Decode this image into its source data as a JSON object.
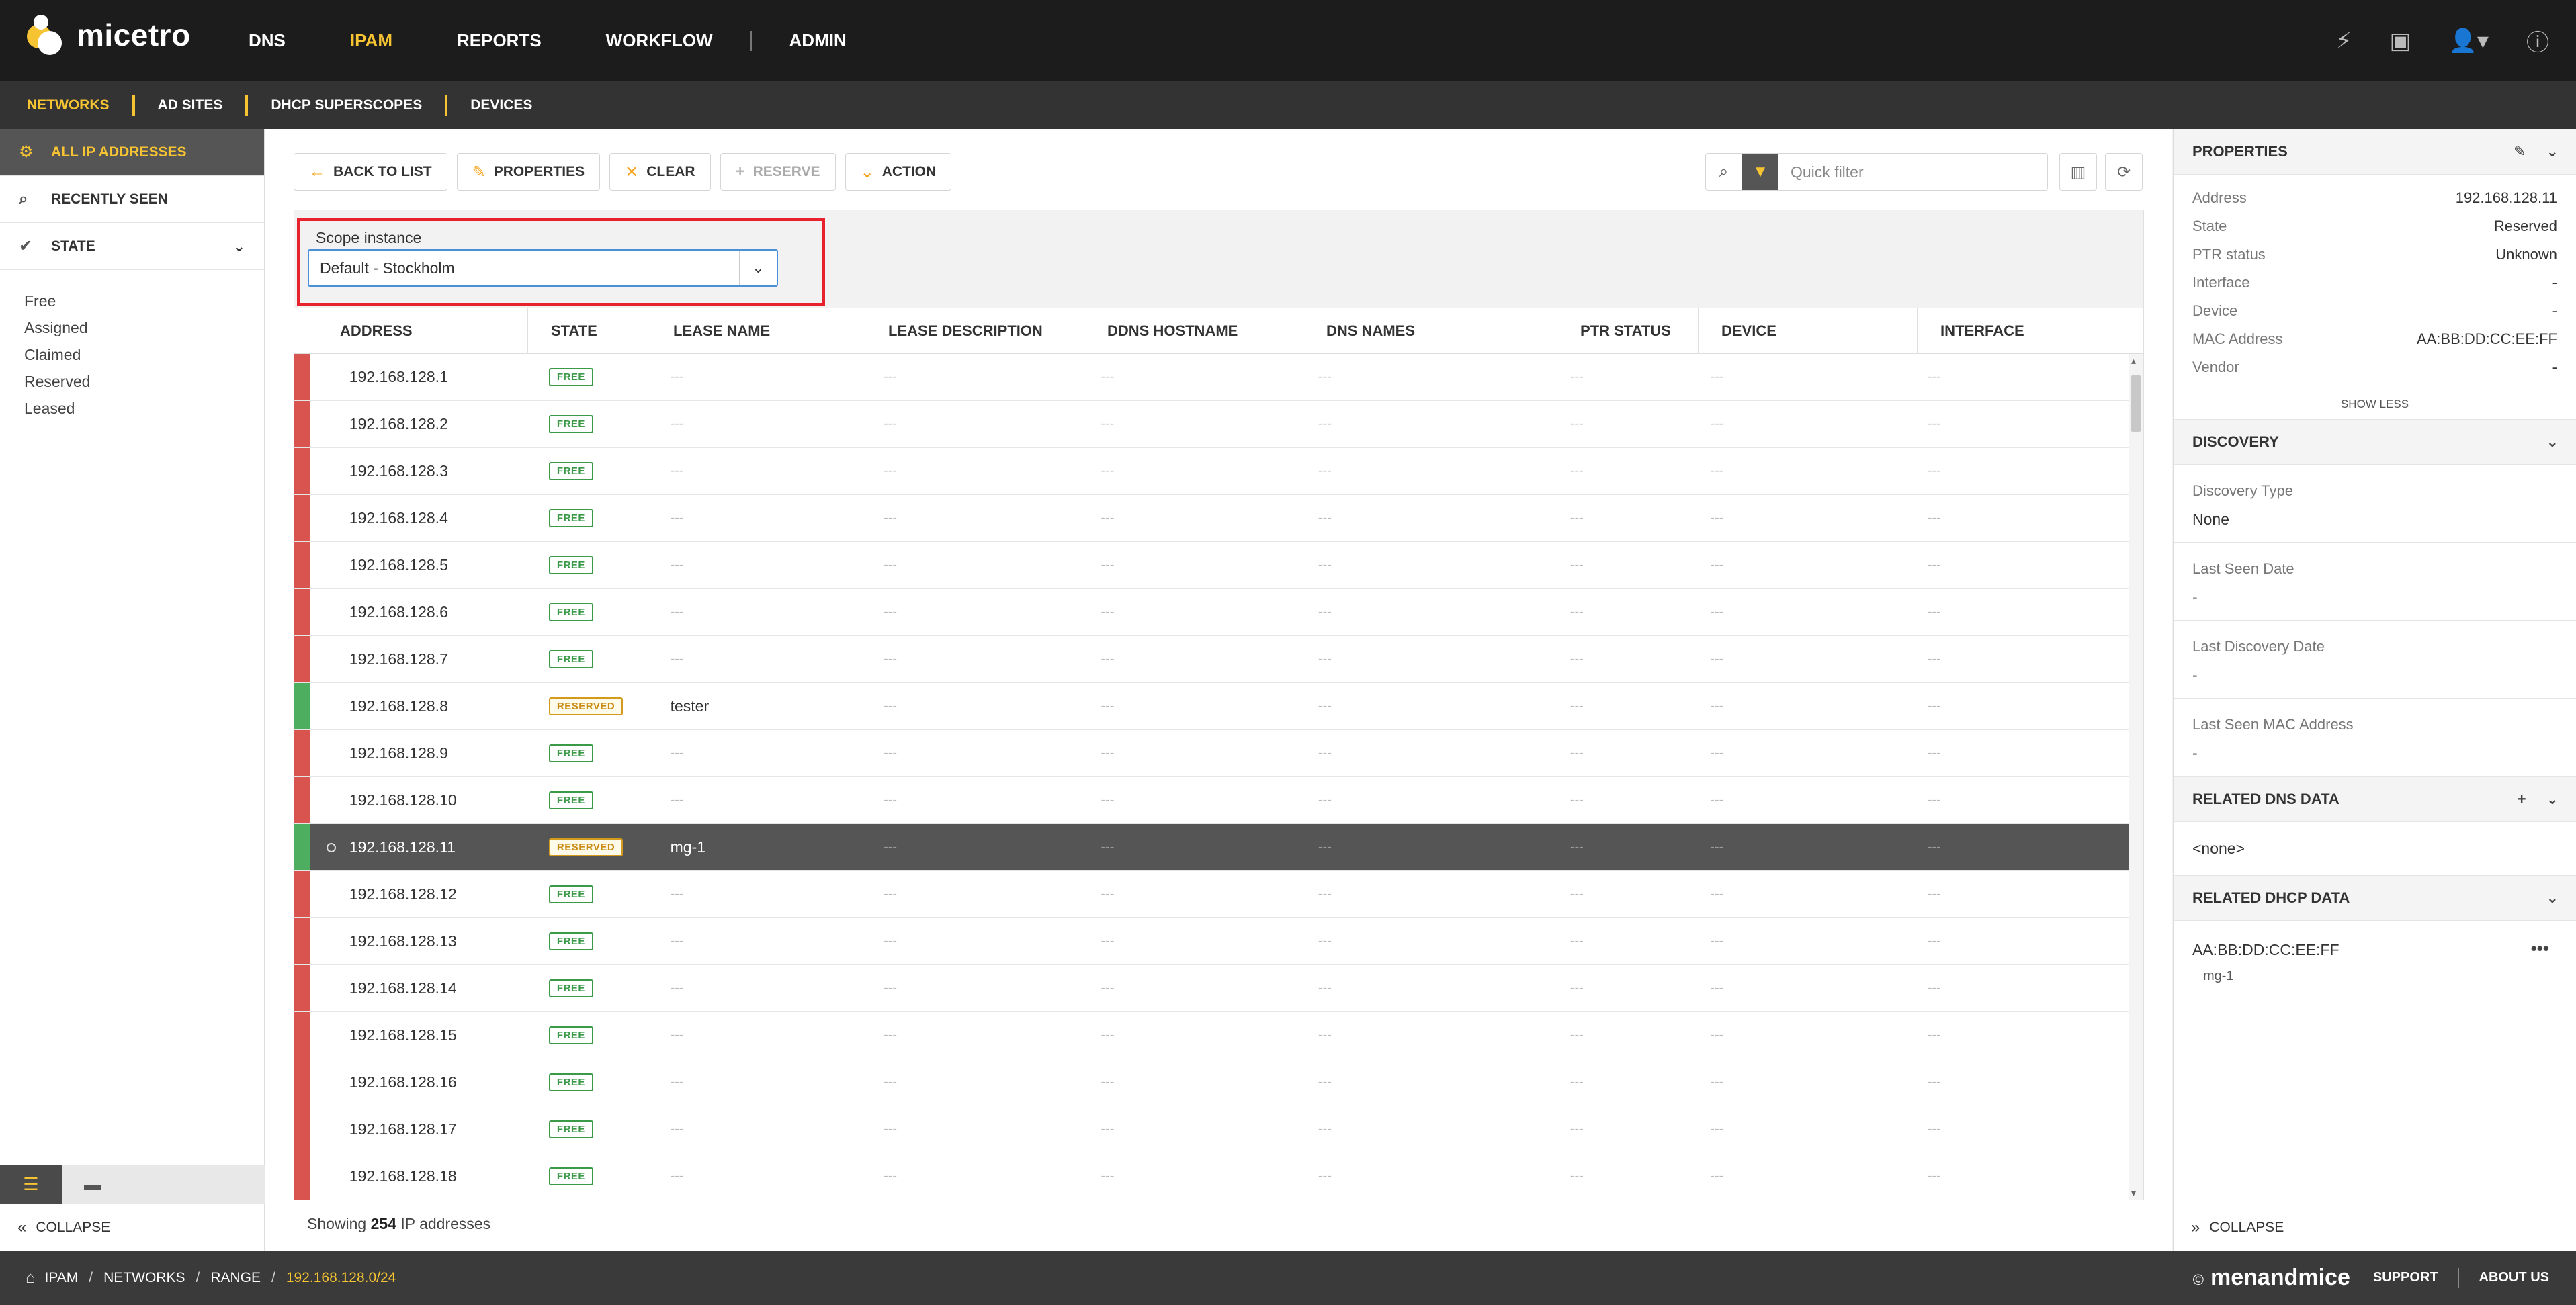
{
  "app": {
    "name": "micetro"
  },
  "nav": {
    "items": [
      {
        "label": "DNS",
        "active": false
      },
      {
        "label": "IPAM",
        "active": true
      },
      {
        "label": "REPORTS",
        "active": false
      },
      {
        "label": "WORKFLOW",
        "active": false
      },
      {
        "label": "ADMIN",
        "active": false
      }
    ]
  },
  "subnav": {
    "items": [
      {
        "label": "NETWORKS",
        "active": true
      },
      {
        "label": "AD SITES",
        "active": false
      },
      {
        "label": "DHCP SUPERSCOPES",
        "active": false
      },
      {
        "label": "DEVICES",
        "active": false
      }
    ]
  },
  "sidebar": {
    "items": [
      {
        "label": "ALL IP ADDRESSES",
        "icon": "gear-icon",
        "active": true
      },
      {
        "label": "RECENTLY SEEN",
        "icon": "magnifier-clock-icon",
        "active": false
      },
      {
        "label": "STATE",
        "icon": "check-circle-icon",
        "active": false
      }
    ],
    "states": [
      "Free",
      "Assigned",
      "Claimed",
      "Reserved",
      "Leased"
    ],
    "collapse_label": "COLLAPSE"
  },
  "toolbar": {
    "back": "BACK TO LIST",
    "properties": "PROPERTIES",
    "clear": "CLEAR",
    "reserve": "RESERVE",
    "action": "ACTION"
  },
  "search": {
    "placeholder": "Quick filter"
  },
  "scope": {
    "label": "Scope instance",
    "value": "Default - Stockholm"
  },
  "table": {
    "columns": [
      "ADDRESS",
      "STATE",
      "LEASE NAME",
      "LEASE DESCRIPTION",
      "DDNS HOSTNAME",
      "DNS NAMES",
      "PTR STATUS",
      "DEVICE",
      "INTERFACE"
    ],
    "empty": "---",
    "rows": [
      {
        "address": "192.168.128.1",
        "state": "FREE",
        "lease": "",
        "status_color": "#d9534f",
        "selected": false
      },
      {
        "address": "192.168.128.2",
        "state": "FREE",
        "lease": "",
        "status_color": "#d9534f",
        "selected": false
      },
      {
        "address": "192.168.128.3",
        "state": "FREE",
        "lease": "",
        "status_color": "#d9534f",
        "selected": false
      },
      {
        "address": "192.168.128.4",
        "state": "FREE",
        "lease": "",
        "status_color": "#d9534f",
        "selected": false
      },
      {
        "address": "192.168.128.5",
        "state": "FREE",
        "lease": "",
        "status_color": "#d9534f",
        "selected": false
      },
      {
        "address": "192.168.128.6",
        "state": "FREE",
        "lease": "",
        "status_color": "#d9534f",
        "selected": false
      },
      {
        "address": "192.168.128.7",
        "state": "FREE",
        "lease": "",
        "status_color": "#d9534f",
        "selected": false
      },
      {
        "address": "192.168.128.8",
        "state": "RESERVED",
        "lease": "tester",
        "status_color": "#4cae5e",
        "selected": false
      },
      {
        "address": "192.168.128.9",
        "state": "FREE",
        "lease": "",
        "status_color": "#d9534f",
        "selected": false
      },
      {
        "address": "192.168.128.10",
        "state": "FREE",
        "lease": "",
        "status_color": "#d9534f",
        "selected": false
      },
      {
        "address": "192.168.128.11",
        "state": "RESERVED",
        "lease": "mg-1",
        "status_color": "#4cae5e",
        "selected": true
      },
      {
        "address": "192.168.128.12",
        "state": "FREE",
        "lease": "",
        "status_color": "#d9534f",
        "selected": false
      },
      {
        "address": "192.168.128.13",
        "state": "FREE",
        "lease": "",
        "status_color": "#d9534f",
        "selected": false
      },
      {
        "address": "192.168.128.14",
        "state": "FREE",
        "lease": "",
        "status_color": "#d9534f",
        "selected": false
      },
      {
        "address": "192.168.128.15",
        "state": "FREE",
        "lease": "",
        "status_color": "#d9534f",
        "selected": false
      },
      {
        "address": "192.168.128.16",
        "state": "FREE",
        "lease": "",
        "status_color": "#d9534f",
        "selected": false
      },
      {
        "address": "192.168.128.17",
        "state": "FREE",
        "lease": "",
        "status_color": "#d9534f",
        "selected": false
      },
      {
        "address": "192.168.128.18",
        "state": "FREE",
        "lease": "",
        "status_color": "#d9534f",
        "selected": false
      }
    ]
  },
  "footer_status": {
    "prefix": "Showing",
    "count": "254",
    "suffix": "IP addresses"
  },
  "properties": {
    "title": "PROPERTIES",
    "rows": [
      {
        "key": "Address",
        "value": "192.168.128.11"
      },
      {
        "key": "State",
        "value": "Reserved"
      },
      {
        "key": "PTR status",
        "value": "Unknown"
      },
      {
        "key": "Interface",
        "value": "-"
      },
      {
        "key": "Device",
        "value": "-"
      },
      {
        "key": "MAC Address",
        "value": "AA:BB:DD:CC:EE:FF"
      },
      {
        "key": "Vendor",
        "value": "-"
      }
    ],
    "show_less": "SHOW LESS"
  },
  "discovery": {
    "title": "DISCOVERY",
    "items": [
      {
        "key": "Discovery Type",
        "value": "None"
      },
      {
        "key": "Last Seen Date",
        "value": "-"
      },
      {
        "key": "Last Discovery Date",
        "value": "-"
      },
      {
        "key": "Last Seen MAC Address",
        "value": "-"
      }
    ]
  },
  "related_dns": {
    "title": "RELATED DNS DATA",
    "value": "<none>"
  },
  "related_dhcp": {
    "title": "RELATED DHCP DATA",
    "mac": "AA:BB:DD:CC:EE:FF",
    "name": "mg-1"
  },
  "right_collapse": "COLLAPSE",
  "breadcrumb": [
    "IPAM",
    "NETWORKS",
    "RANGE",
    "192.168.128.0/24"
  ],
  "footer": {
    "copyright": "©",
    "brand": "menandmice",
    "support": "SUPPORT",
    "about": "ABOUT US"
  },
  "colors": {
    "accent": "#f6c433",
    "free": "#3a9a48",
    "reserved": "#c88a10",
    "highlight": "#e8212f"
  }
}
